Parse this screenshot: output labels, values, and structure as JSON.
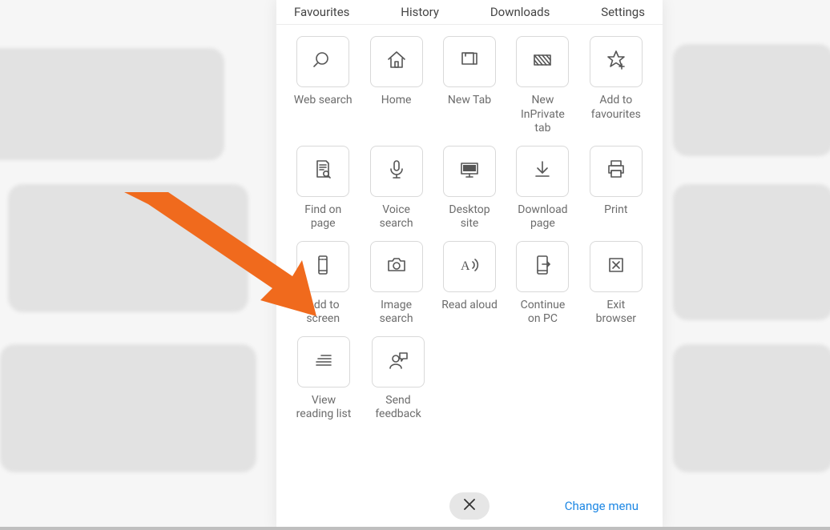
{
  "tabs": [
    {
      "id": "favourites",
      "label": "Favourites"
    },
    {
      "id": "history",
      "label": "History"
    },
    {
      "id": "downloads",
      "label": "Downloads"
    },
    {
      "id": "settings",
      "label": "Settings"
    }
  ],
  "tiles": {
    "r1": [
      {
        "id": "web-search",
        "icon": "search",
        "label": "Web search"
      },
      {
        "id": "home",
        "icon": "home",
        "label": "Home"
      },
      {
        "id": "new-tab",
        "icon": "new-tab",
        "label": "New Tab"
      },
      {
        "id": "new-inprivate",
        "icon": "inprivate",
        "label": "New\nInPrivate\ntab"
      },
      {
        "id": "add-favourites",
        "icon": "star-plus",
        "label": "Add to\nfavourites"
      }
    ],
    "r2": [
      {
        "id": "find-on-page",
        "icon": "find",
        "label": "Find on\npage"
      },
      {
        "id": "voice-search",
        "icon": "mic",
        "label": "Voice\nsearch"
      },
      {
        "id": "desktop-site",
        "icon": "desktop",
        "label": "Desktop\nsite"
      },
      {
        "id": "download-page",
        "icon": "download",
        "label": "Download\npage"
      },
      {
        "id": "print",
        "icon": "print",
        "label": "Print"
      }
    ],
    "r3": [
      {
        "id": "add-to-screen",
        "icon": "phone",
        "label": "Add to\nscreen"
      },
      {
        "id": "image-search",
        "icon": "camera",
        "label": "Image\nsearch"
      },
      {
        "id": "read-aloud",
        "icon": "read-aloud",
        "label": "Read aloud"
      },
      {
        "id": "continue-pc",
        "icon": "continue-pc",
        "label": "Continue\non PC"
      },
      {
        "id": "exit-browser",
        "icon": "exit",
        "label": "Exit\nbrowser"
      }
    ],
    "r4": [
      {
        "id": "view-reading",
        "icon": "reading-list",
        "label": "View\nreading list"
      },
      {
        "id": "send-feedback",
        "icon": "feedback",
        "label": "Send\nfeedback"
      }
    ]
  },
  "footer": {
    "close_label": "Close",
    "change_label": "Change menu"
  }
}
